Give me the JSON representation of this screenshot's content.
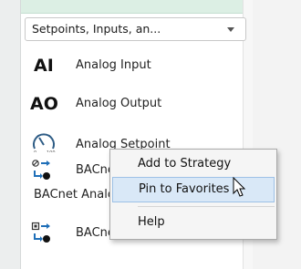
{
  "dropdown": {
    "value": "Setpoints, Inputs, an..."
  },
  "items": [
    {
      "abbr": "AI",
      "label": "Analog Input"
    },
    {
      "abbr": "AO",
      "label": "Analog Output"
    },
    {
      "label": "Analog Setpoint",
      "icon": "gauge-icon"
    },
    {
      "label": "BACnet Analog",
      "icon": "bacnet-icon"
    },
    {
      "label": "BACnet Analog"
    },
    {
      "label": "BACnet Binary",
      "icon": "bacnet-binary-icon"
    }
  ],
  "context_menu": [
    {
      "label": "Add to Strategy"
    },
    {
      "label": "Pin to Favorites"
    },
    {
      "label": "Help"
    }
  ],
  "cursor": "mouse-pointer-icon"
}
